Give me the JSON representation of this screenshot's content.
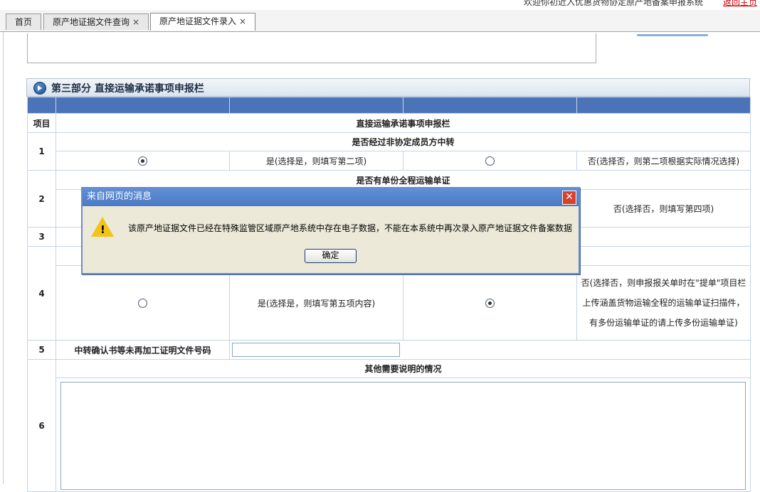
{
  "topbar": {
    "welcome": "欢迎你初近入优惠货物协定原产地备案申报系统",
    "back_link": "返回主页"
  },
  "tabs": [
    {
      "label": "首页",
      "close": ""
    },
    {
      "label": "原产地证据文件查询",
      "close": "×"
    },
    {
      "label": "原产地证据文件录入",
      "close": "×"
    }
  ],
  "section": {
    "title": "第三部分 直接运输承诺事项申报栏"
  },
  "table": {
    "col_item": "项目",
    "main_header": "直接运输承诺事项申报栏",
    "q1": {
      "num": "1",
      "title": "是否经过非协定成员方中转",
      "yes": "是(选择是，则填写第二项)",
      "no": "否(选择否，则第二项根据实际情况选择)",
      "yes_checked": true,
      "no_checked": false
    },
    "q2": {
      "num": "2",
      "title": "是否有单份全程运输单证",
      "no": "否(选择否，则填写第四项)"
    },
    "q3": {
      "num": "3"
    },
    "q4": {
      "num": "4",
      "yes": "是(选择是，则填写第五项内容)",
      "no": "否(选择否，则申报报关单时在\"提单\"项目栏上传涵盖货物运输全程的运输单证扫描件，有多份运输单证的请上传多份运输单证)",
      "yes_checked": false,
      "no_checked": true
    },
    "q5": {
      "num": "5",
      "label": "中转确认书等未再加工证明文件号码",
      "value": ""
    },
    "q6": {
      "num": "6",
      "title": "其他需要说明的情况",
      "value": ""
    }
  },
  "dialog": {
    "title": "来自网页的消息",
    "message": "该原产地证据文件已经在特殊监管区域原产地系统中存在电子数据，不能在本系统中再次录入原产地证据文件备案数据",
    "ok": "确定",
    "close": "✕"
  }
}
